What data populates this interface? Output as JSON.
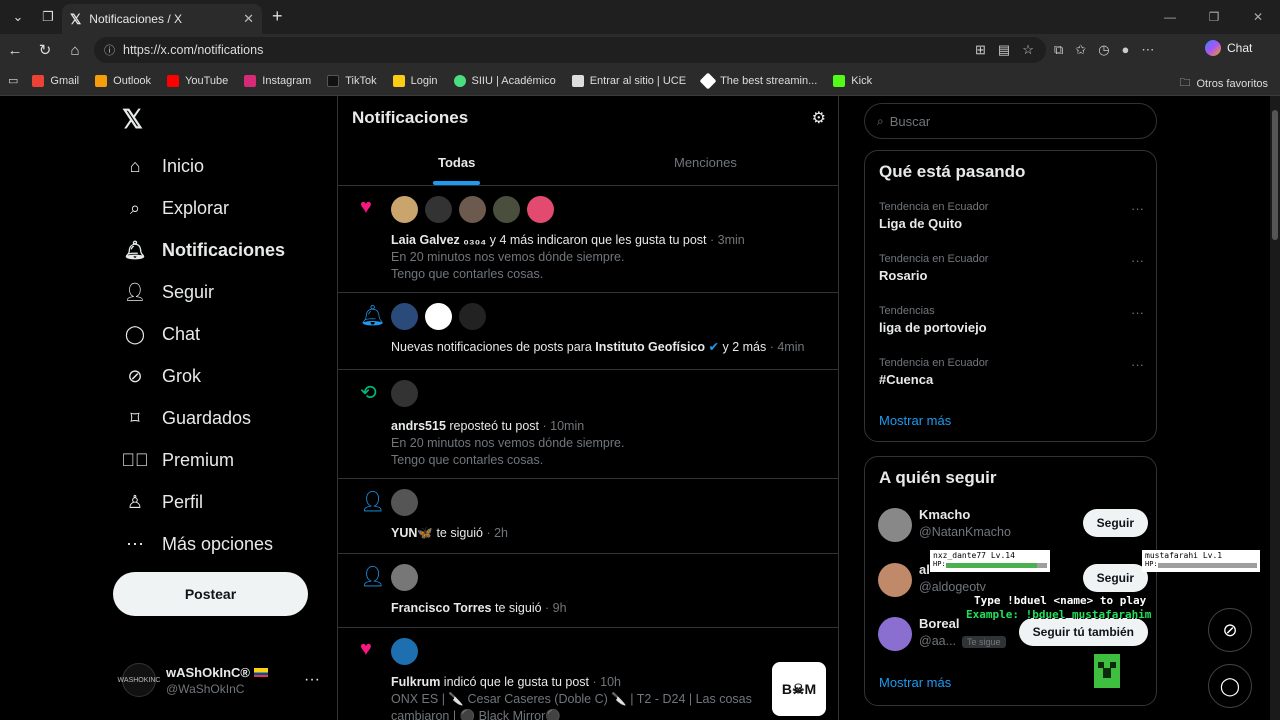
{
  "browser": {
    "tab_title": "Notificaciones / X",
    "url": "https://x.com/notifications",
    "chat_label": "Chat",
    "bookmarks": [
      "Gmail",
      "Outlook",
      "YouTube",
      "Instagram",
      "TikTok",
      "Login",
      "SIIU | Académico",
      "Entrar al sitio | UCE",
      "The best streamin...",
      "Kick"
    ],
    "other_bookmarks": "Otros favoritos"
  },
  "sidebar": {
    "items": [
      {
        "label": "Inicio",
        "icon": "home-icon"
      },
      {
        "label": "Explorar",
        "icon": "search-icon"
      },
      {
        "label": "Notificaciones",
        "icon": "bell-icon"
      },
      {
        "label": "Seguir",
        "icon": "follow-icon"
      },
      {
        "label": "Chat",
        "icon": "chat-icon"
      },
      {
        "label": "Grok",
        "icon": "grok-icon"
      },
      {
        "label": "Guardados",
        "icon": "bookmark-icon"
      },
      {
        "label": "Premium",
        "icon": "premium-icon"
      },
      {
        "label": "Perfil",
        "icon": "profile-icon"
      },
      {
        "label": "Más opciones",
        "icon": "more-icon"
      }
    ],
    "post_button": "Postear",
    "profile": {
      "name": "wAShOkInC®",
      "handle": "@WaShOkInC",
      "more": "···",
      "avatar_text": "WASHOKINC"
    }
  },
  "main": {
    "title": "Notificaciones",
    "tabs": [
      "Todas",
      "Menciones"
    ],
    "notifications": [
      {
        "type": "like",
        "user": "Laia Galvez ₀₃₀₄",
        "action": " y 4 más indicaron que les gusta tu post",
        "time": " · 3min",
        "line1": "En 20 minutos nos vemos dónde siempre.",
        "line2": "Tengo que contarles cosas."
      },
      {
        "type": "bell",
        "prefix": "Nuevas notificaciones de posts para ",
        "user": "Instituto Geofísico",
        "action": " y 2 más",
        "time": " · 4min"
      },
      {
        "type": "repost",
        "user": "andrs515",
        "action": " reposteó tu post",
        "time": " · 10min",
        "line1": "En 20 minutos nos vemos dónde siempre.",
        "line2": "Tengo que contarles cosas."
      },
      {
        "type": "follow",
        "user": "YUN🦋",
        "action": " te siguió",
        "time": " · 2h"
      },
      {
        "type": "follow",
        "user": "Francisco Torres",
        "action": " te siguió",
        "time": " · 9h"
      },
      {
        "type": "like",
        "user": "Fulkrum",
        "action": " indicó que le gusta tu post",
        "time": " · 10h",
        "line1": "ONX ES | 🔪 Cesar Caseres (Doble C) 🔪 | T2 - D24 | Las cosas",
        "line2": "cambiaron | ⚫ Black Mirror⚫",
        "thumb": "B☠M"
      }
    ]
  },
  "right": {
    "search_placeholder": "Buscar",
    "trends_title": "Qué está pasando",
    "trends": [
      {
        "category": "Tendencia en Ecuador",
        "name": "Liga de Quito"
      },
      {
        "category": "Tendencia en Ecuador",
        "name": "Rosario"
      },
      {
        "category": "Tendencias",
        "name": "liga de portoviejo"
      },
      {
        "category": "Tendencia en Ecuador",
        "name": "#Cuenca"
      }
    ],
    "show_more": "Mostrar más",
    "follow_title": "A quién seguir",
    "follow": [
      {
        "name": "Kmacho",
        "handle": "@NatanKmacho",
        "button": "Seguir"
      },
      {
        "name": "al",
        "handle": "@aldogeotv",
        "button": "Seguir"
      },
      {
        "name": "Boreal",
        "handle": "@aa...",
        "badge": "Te sigue",
        "button": "Seguir tú también"
      }
    ],
    "show_more2": "Mostrar más"
  },
  "overlay": {
    "player1": {
      "name": "nxz_dante77",
      "level": "Lv.14",
      "hp_label": "HP:",
      "hp": 0.9
    },
    "player2": {
      "name": "mustafarahi",
      "level": "Lv.1",
      "hp_label": "HP:",
      "hp": 0.0
    },
    "line1": "Type !bduel <name> to play",
    "line2": "Example: !bduel mustafarahim"
  }
}
